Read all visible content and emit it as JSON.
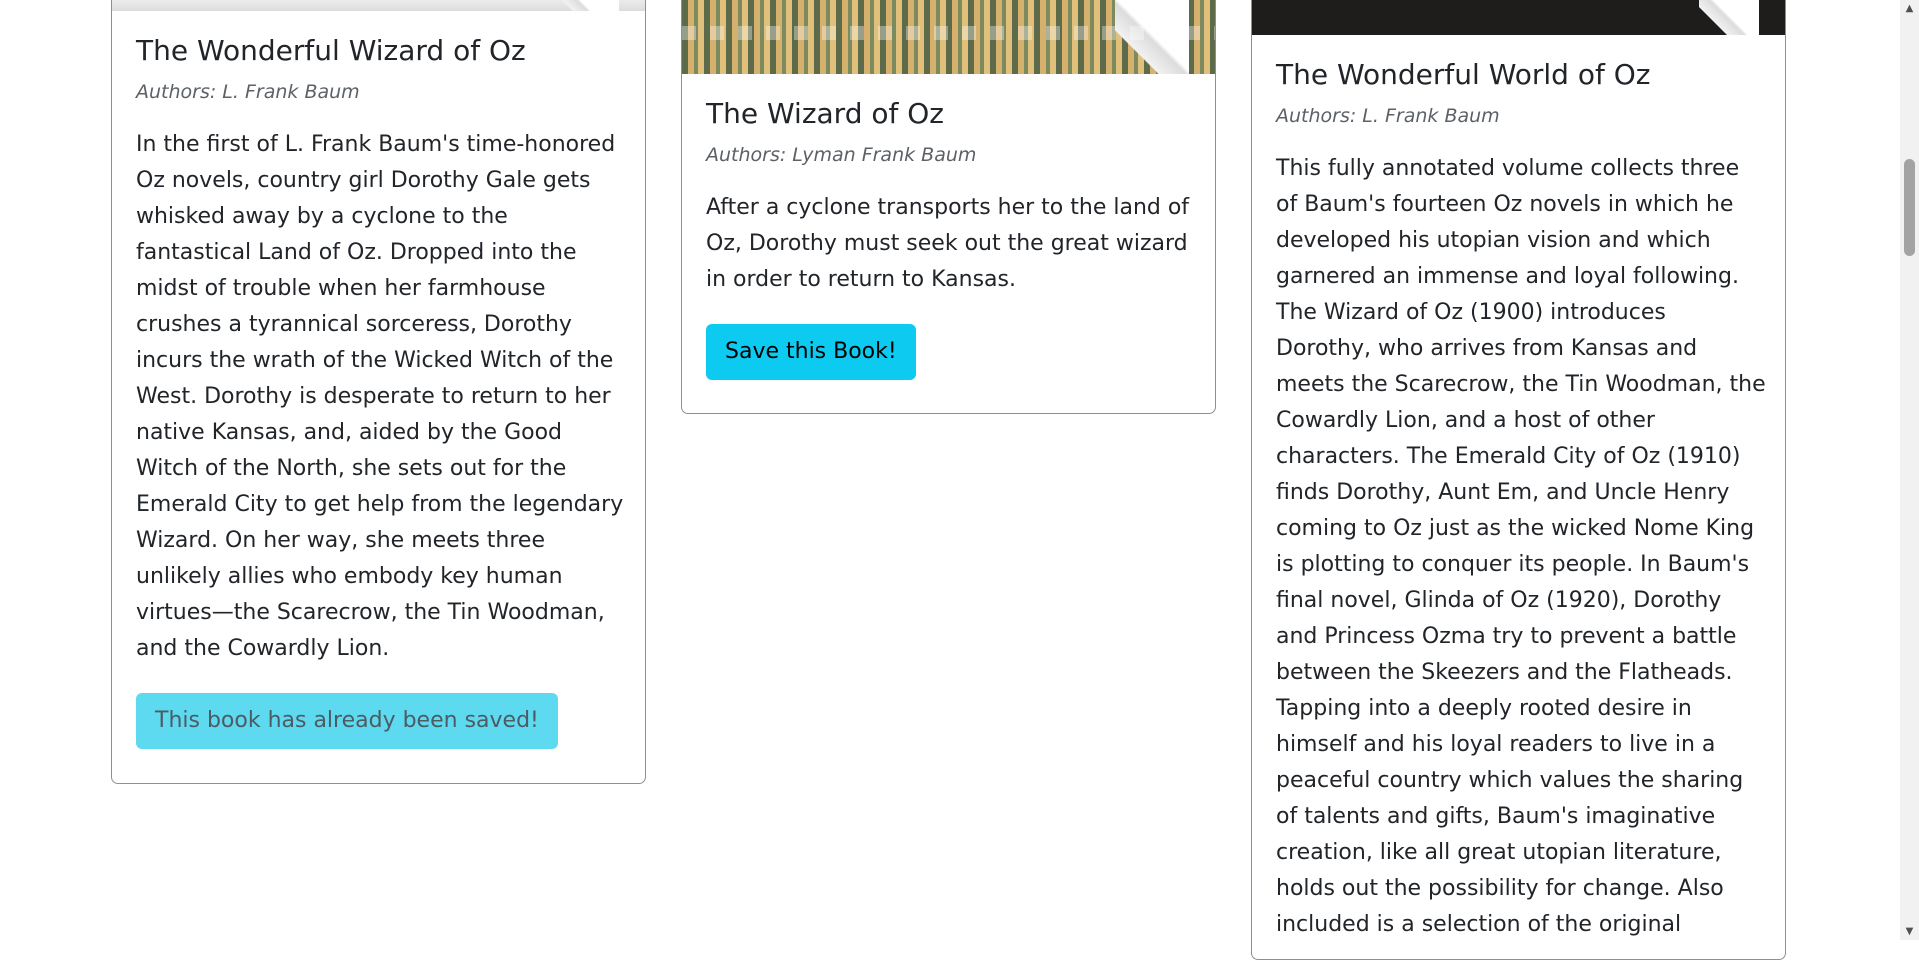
{
  "books": [
    {
      "title": "The Wonderful Wizard of Oz",
      "authors": "Authors: L. Frank Baum",
      "description": "In the first of L. Frank Baum's time-honored Oz novels, country girl Dorothy Gale gets whisked away by a cyclone to the fantastical Land of Oz. Dropped into the midst of trouble when her farmhouse crushes a tyrannical sorceress, Dorothy incurs the wrath of the Wicked Witch of the West. Dorothy is desperate to return to her native Kansas, and, aided by the Good Witch of the North, she sets out for the Emerald City to get help from the legendary Wizard. On her way, she meets three unlikely allies who embody key human virtues—the Scarecrow, the Tin Woodman, and the Cowardly Lion.",
      "button_label": "This book has already been saved!",
      "saved": true
    },
    {
      "title": "The Wizard of Oz",
      "authors": "Authors: Lyman Frank Baum",
      "description": "After a cyclone transports her to the land of Oz, Dorothy must seek out the great wizard in order to return to Kansas.",
      "button_label": "Save this Book!",
      "saved": false
    },
    {
      "title": "The Wonderful World of Oz",
      "authors": "Authors: L. Frank Baum",
      "description": "This fully annotated volume collects three of Baum's fourteen Oz novels in which he developed his utopian vision and which garnered an immense and loyal following. The Wizard of Oz (1900) introduces Dorothy, who arrives from Kansas and meets the Scarecrow, the Tin Woodman, the Cowardly Lion, and a host of other characters. The Emerald City of Oz (1910) finds Dorothy, Aunt Em, and Uncle Henry coming to Oz just as the wicked Nome King is plotting to conquer its people. In Baum's final novel, Glinda of Oz (1920), Dorothy and Princess Ozma try to prevent a battle between the Skeezers and the Flatheads. Tapping into a deeply rooted desire in himself and his loyal readers to live in a peaceful country which values the sharing of talents and gifts, Baum's imaginative creation, like all great utopian literature, holds out the possibility for change. Also included is a selection of the original",
      "button_label": "",
      "saved": false
    }
  ],
  "colors": {
    "saved_button": "#5ddaf0",
    "save_button": "#0dcaf0",
    "card_border": "#8f8f8f"
  },
  "scrollbar": {
    "up_arrow": "▲",
    "down_arrow": "▼"
  }
}
